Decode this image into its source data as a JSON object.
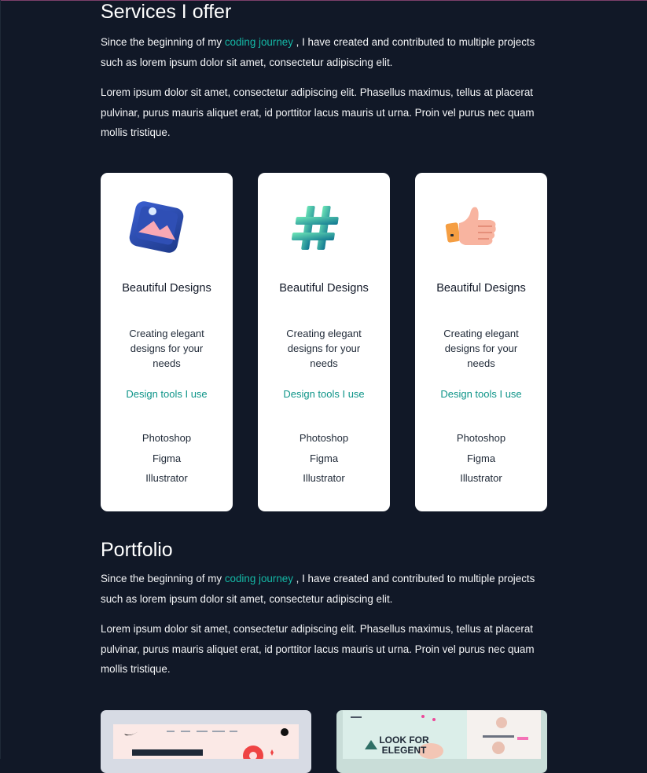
{
  "services": {
    "heading": "Services I offer",
    "intro_before": "Since the beginning of my ",
    "intro_link": "coding journey",
    "intro_after": " , I have created and contributed to multiple projects such as lorem ipsum dolor sit amet, consectetur adipiscing elit.",
    "paragraph": "Lorem ipsum dolor sit amet, consectetur adipiscing elit. Phasellus maximus, tellus at placerat pulvinar, purus mauris aliquet erat, id porttitor lacus mauris ut urna. Proin vel purus nec quam mollis tristique.",
    "cards": [
      {
        "icon": "image-gallery-icon",
        "title": "Beautiful Designs",
        "description": "Creating elegant designs for your needs",
        "tools_heading": "Design tools I use",
        "tools": [
          "Photoshop",
          "Figma",
          "Illustrator"
        ]
      },
      {
        "icon": "hashtag-icon",
        "title": "Beautiful Designs",
        "description": "Creating elegant designs for your needs",
        "tools_heading": "Design tools I use",
        "tools": [
          "Photoshop",
          "Figma",
          "Illustrator"
        ]
      },
      {
        "icon": "thumbs-up-icon",
        "title": "Beautiful Designs",
        "description": "Creating elegant designs for your needs",
        "tools_heading": "Design tools I use",
        "tools": [
          "Photoshop",
          "Figma",
          "Illustrator"
        ]
      }
    ]
  },
  "portfolio": {
    "heading": "Portfolio",
    "intro_before": "Since the beginning of my ",
    "intro_link": "coding journey",
    "intro_after": " , I have created and contributed to multiple projects such as lorem ipsum dolor sit amet, consectetur adipiscing elit.",
    "paragraph": "Lorem ipsum dolor sit amet, consectetur adipiscing elit. Phasellus maximus, tellus at placerat pulvinar, purus mauris aliquet erat, id porttitor lacus mauris ut urna. Proin vel purus nec quam mollis tristique.",
    "thumb2_text": "LOOK FOR ELEGENT"
  },
  "colors": {
    "background": "#111827",
    "accent": "#14b8a6",
    "card_link": "#0d9488"
  }
}
